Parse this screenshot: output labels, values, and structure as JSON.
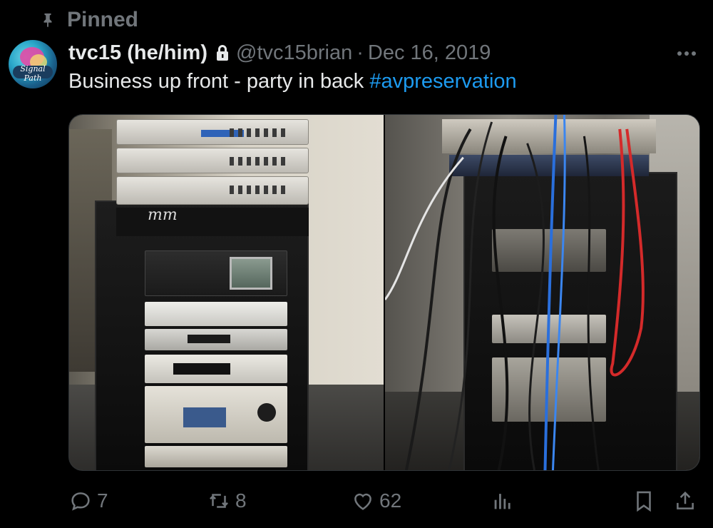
{
  "pinned": {
    "label": "Pinned",
    "icon": "pin-icon"
  },
  "author": {
    "display_name": "tvc15 (he/him)",
    "handle": "@tvc15brian",
    "date": "Dec 16, 2019",
    "protected_icon": "lock-icon",
    "avatar_text": "Signal Path"
  },
  "tweet": {
    "text": "Business up front - party in back",
    "hashtag": "#avpreservation"
  },
  "media": {
    "photos": [
      {
        "name": "front-of-rack-photo",
        "logo_text": "mm"
      },
      {
        "name": "back-of-rack-photo"
      }
    ]
  },
  "actions": {
    "reply_count": "7",
    "retweet_count": "8",
    "like_count": "62"
  },
  "colors": {
    "background": "#000000",
    "text": "#e7e9ea",
    "secondary": "#71767b",
    "link": "#1d9bf0"
  }
}
